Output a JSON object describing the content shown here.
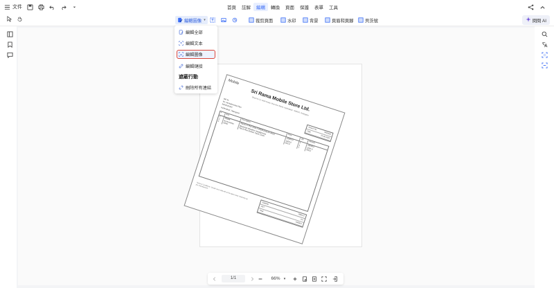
{
  "topbar": {
    "file_label": "文件",
    "menu": [
      "首頁",
      "註解",
      "編輯",
      "轉換",
      "頁面",
      "保護",
      "表單",
      "工具"
    ],
    "active_menu_index": 2
  },
  "toolbar": {
    "edit_image_label": "編輯圖像",
    "crop_page_label": "裁剪頁面",
    "watermark_label": "水印",
    "background_label": "背景",
    "header_footer_label": "頁眉和頁腳",
    "bates_label": "貝茨號",
    "ask_ai_label": "問問 AI"
  },
  "dropdown": {
    "items": [
      "編輯全部",
      "編輯文本",
      "編輯圖像",
      "編輯鏈接"
    ],
    "highlighted_index": 2,
    "heading": "遮蔽行動",
    "remove_links_label": "刪除所有連結"
  },
  "invoice": {
    "logo_text": "Mobile",
    "store_name": "Sri Rama Mobile Store Ltd.",
    "address": "Shop No 12, Main Road, Near Bus Stand, Hyderabad - 500001, Telangana",
    "bill_to": [
      "Bill To:",
      "Mr. Venkateswara Rao",
      "9000000000",
      "Hyderabad, Telangana"
    ],
    "meta": [
      {
        "k": "Invoice No.",
        "v": "SR/0345"
      },
      {
        "k": "Date",
        "v": "21-06-2023"
      }
    ],
    "table_headers": [
      "#",
      "Item",
      "Description",
      "Price",
      "Qty",
      "Amount"
    ],
    "rows": [
      {
        "n": "1",
        "item": "Mobile",
        "desc": "Xiaomi 5 Plus Note 8 64GB (Glacier Blue)",
        "price": "18000.0",
        "qty": "1",
        "amt": "18000.0"
      },
      {
        "n": "2",
        "item": "Accessories",
        "desc": "Bluetooth Wireless Headphones",
        "price": "1200.0",
        "qty": "1",
        "amt": "1200.0"
      },
      {
        "n": "3",
        "item": "Other",
        "desc": "Flip & Plus Screen Case Cover",
        "price": "300.0",
        "qty": "1",
        "amt": "300.0"
      }
    ],
    "totals": [
      {
        "k": "Subtotal",
        "v": "19500.0"
      },
      {
        "k": "GST",
        "v": "0.0"
      },
      {
        "k": "Total",
        "v": "19500.0"
      }
    ],
    "note": "Terms & Conditions: Goods once sold will not be taken back. Warranty as per manufacturer."
  },
  "bottom": {
    "page_indicator": "1/1",
    "zoom": "66%"
  },
  "colors": {
    "accent": "#3b6df6",
    "highlight_border": "#d9453a"
  }
}
